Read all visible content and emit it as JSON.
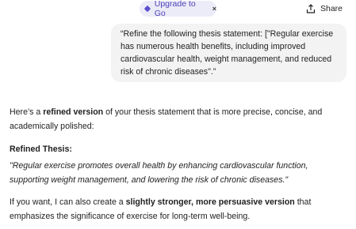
{
  "top_bar": {
    "upgrade_label": "Upgrade to Go",
    "upgrade_close": "×",
    "share_label": "Share"
  },
  "user_message": {
    "text": "“Refine the following thesis statement: [\"Regular exercise has numerous health benefits, including improved cardiovascular health, weight management, and reduced risk of chronic diseases\".”"
  },
  "response": {
    "intro_prefix": "Here’s a ",
    "intro_bold": "refined version",
    "intro_suffix": " of your thesis statement that is more precise, concise, and academically polished:",
    "refined_heading": "Refined Thesis:",
    "refined_text": "\"Regular exercise promotes overall health by enhancing cardiovascular function, supporting weight management, and lowering the risk of chronic diseases.\"",
    "followup_prefix": "If you want, I can also create a ",
    "followup_bold": "slightly stronger, more persuasive version",
    "followup_suffix": " that emphasizes the significance of exercise for long-term well-being."
  },
  "colors": {
    "accent": "#5a4fcf",
    "pill_bg": "#ecebf8",
    "bubble_bg": "#f3f3f3"
  },
  "icons": {
    "upgrade": "diamond-icon",
    "share": "share-icon",
    "close": "close-icon"
  }
}
